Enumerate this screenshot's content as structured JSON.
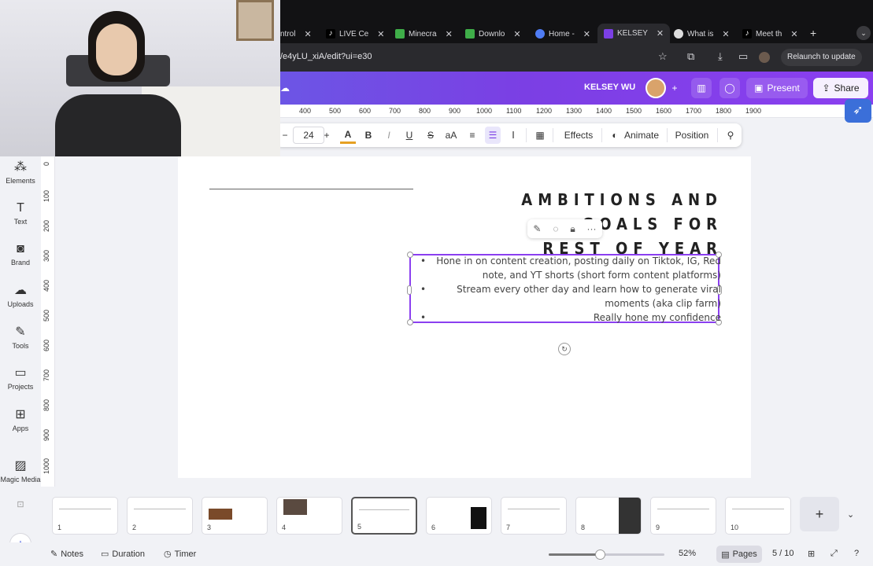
{
  "browser": {
    "tabs": [
      {
        "label": "ntrol",
        "icon": "generic-tab-icon",
        "color": "#888888"
      },
      {
        "label": "LIVE Ce",
        "icon": "tiktok-icon",
        "color": "#ffffff"
      },
      {
        "label": "Minecra",
        "icon": "minecraft-icon",
        "color": "#3fae49"
      },
      {
        "label": "Downlo",
        "icon": "minecraft-icon",
        "color": "#3fae49"
      },
      {
        "label": "Home -",
        "icon": "canva-icon",
        "color": "#4f7cf4"
      },
      {
        "label": "KELSEY",
        "icon": "canva-icon",
        "color": "#7b3fe4",
        "active": true
      },
      {
        "label": "What is",
        "icon": "chatgpt-icon",
        "color": "#dddddd"
      },
      {
        "label": "Meet th",
        "icon": "tiktok-icon",
        "color": "#ffffff"
      }
    ],
    "url": "/e4yLU_xiA/edit?ui=e30",
    "relaunch_label": "Relaunch to update"
  },
  "canva": {
    "user_name": "KELSEY WU",
    "present_label": "Present",
    "share_label": "Share",
    "accent": "#7b3fe4"
  },
  "ruler": {
    "ticks": [
      "400",
      "500",
      "600",
      "700",
      "800",
      "900",
      "1000",
      "1100",
      "1200",
      "1300",
      "1400",
      "1500",
      "1600",
      "1700",
      "1800",
      "1900"
    ]
  },
  "vertical_ruler": {
    "ticks": [
      "0",
      "100",
      "200",
      "300",
      "400",
      "500",
      "600",
      "700",
      "800",
      "900",
      "1000"
    ]
  },
  "text_toolbar": {
    "minus": "−",
    "font_size": "24",
    "plus": "+",
    "effects_label": "Effects",
    "animate_label": "Animate",
    "position_label": "Position"
  },
  "sidebar": {
    "items": [
      {
        "label": "Elements",
        "icon": "elements-icon",
        "glyph": "⁂"
      },
      {
        "label": "Text",
        "icon": "text-icon",
        "glyph": "T"
      },
      {
        "label": "Brand",
        "icon": "brand-icon",
        "glyph": "◙"
      },
      {
        "label": "Uploads",
        "icon": "uploads-icon",
        "glyph": "☁"
      },
      {
        "label": "Tools",
        "icon": "tools-icon",
        "glyph": "✎"
      },
      {
        "label": "Projects",
        "icon": "projects-icon",
        "glyph": "▭"
      },
      {
        "label": "Apps",
        "icon": "apps-icon",
        "glyph": "⊞"
      },
      {
        "label": "Magic Media",
        "icon": "magic-media-icon",
        "glyph": "▨"
      }
    ]
  },
  "slide": {
    "title_line1": "AMBITIONS AND GOALS FOR",
    "title_line2": "REST OF YEAR",
    "bullets": [
      "Hone in on content creation, posting daily on Tiktok, IG, Red note, and YT shorts (short form content platforms)",
      "Stream every other day and learn how to generate viral moments (aka clip farm)",
      "Really hone my confidence"
    ]
  },
  "pages": {
    "thumbnails": [
      "1",
      "2",
      "3",
      "4",
      "5",
      "6",
      "7",
      "8",
      "9",
      "10"
    ],
    "active_page": "5"
  },
  "bottombar": {
    "notes_label": "Notes",
    "duration_label": "Duration",
    "timer_label": "Timer",
    "zoom_fraction": 0.52,
    "zoom_label": "52%",
    "pages_label": "Pages",
    "page_counter": "5 / 10"
  }
}
